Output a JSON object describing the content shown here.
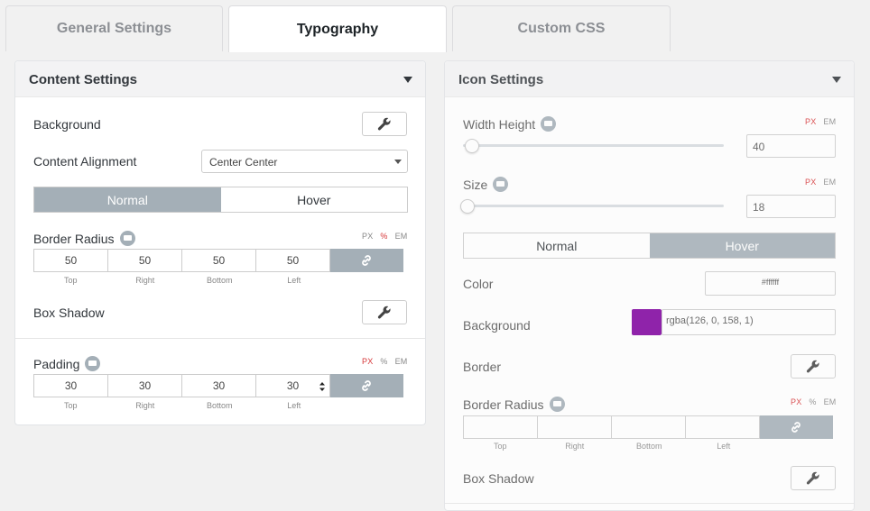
{
  "tabs": [
    {
      "label": "General Settings",
      "active": false
    },
    {
      "label": "Typography",
      "active": true
    },
    {
      "label": "Custom CSS",
      "active": false
    }
  ],
  "content_settings": {
    "title": "Content Settings",
    "background_label": "Background",
    "content_alignment_label": "Content Alignment",
    "content_alignment_value": "Center Center",
    "state_tabs": [
      "Normal",
      "Hover"
    ],
    "active_state": "Normal",
    "border_radius_label": "Border Radius",
    "border_radius_units": [
      "PX",
      "%",
      "EM"
    ],
    "border_radius_active_unit": "%",
    "border_radius_values": [
      "50",
      "50",
      "50",
      "50"
    ],
    "dimension_labels": [
      "Top",
      "Right",
      "Bottom",
      "Left"
    ],
    "box_shadow_label": "Box Shadow",
    "padding_label": "Padding",
    "padding_units": [
      "PX",
      "%",
      "EM"
    ],
    "padding_active_unit": "PX",
    "padding_values": [
      "30",
      "30",
      "30",
      "30"
    ]
  },
  "icon_settings": {
    "title": "Icon Settings",
    "width_height_label": "Width Height",
    "width_height_units": [
      "PX",
      "EM"
    ],
    "width_height_value": "40",
    "size_label": "Size",
    "size_units": [
      "PX",
      "EM"
    ],
    "size_value": "18",
    "state_tabs": [
      "Normal",
      "Hover"
    ],
    "active_state": "Hover",
    "color_label": "Color",
    "color_value": "#ffffff",
    "background_label": "Background",
    "background_value": "rgba(126, 0, 158, 1)",
    "background_swatch": "#7e009e",
    "border_label": "Border",
    "border_radius_label": "Border Radius",
    "border_radius_units": [
      "PX",
      "%",
      "EM"
    ],
    "border_radius_active_unit": "PX",
    "dimension_labels": [
      "Top",
      "Right",
      "Bottom",
      "Left"
    ],
    "box_shadow_label": "Box Shadow"
  },
  "colors": {
    "accent_active_unit": "#d63638",
    "segment_active": "#a4afb7"
  },
  "icons": {
    "wrench": "wrench-icon",
    "link": "link-icon",
    "info": "info-icon",
    "caret": "caret-down-icon"
  }
}
